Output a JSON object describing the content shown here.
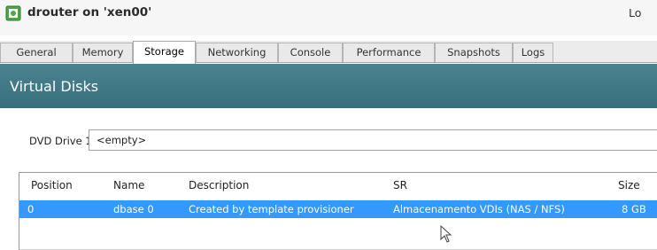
{
  "window": {
    "title": "drouter on 'xen00'",
    "status_text": "Lo",
    "icon": "vm-console-icon"
  },
  "tabs": [
    {
      "label": "General",
      "active": false
    },
    {
      "label": "Memory",
      "active": false
    },
    {
      "label": "Storage",
      "active": true
    },
    {
      "label": "Networking",
      "active": false
    },
    {
      "label": "Console",
      "active": false
    },
    {
      "label": "Performance",
      "active": false
    },
    {
      "label": "Snapshots",
      "active": false
    },
    {
      "label": "Logs",
      "active": false
    }
  ],
  "section": {
    "title": "Virtual Disks"
  },
  "dvd": {
    "label": "DVD Drive 1:",
    "value": "<empty>"
  },
  "disks_table": {
    "columns": [
      "Position",
      "Name",
      "Description",
      "SR",
      "Size"
    ],
    "rows": [
      {
        "position": "0",
        "name": "dbase 0",
        "description": "Created by template provisioner",
        "sr": "Almacenamento VDIs (NAS / NFS)",
        "size": "8 GB",
        "selected": true
      }
    ]
  },
  "colors": {
    "header_band": "#3f7885",
    "selection": "#3399ff",
    "icon_green": "#4aa84a"
  }
}
